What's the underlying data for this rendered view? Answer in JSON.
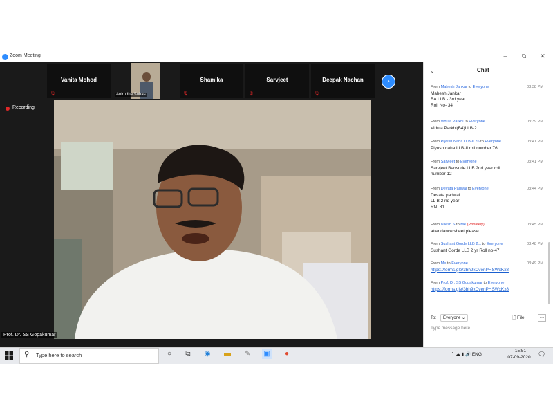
{
  "window": {
    "title": "Zoom Meeting",
    "minimize": "–",
    "restore": "⧉",
    "close": "✕"
  },
  "participants": {
    "names": [
      "Vanita Mohod",
      "Shamika",
      "Sarvjeet",
      "Deepak Nachan"
    ],
    "video_tile_label": "Anirudha Suhas",
    "next_arrow": "›"
  },
  "recording": {
    "label": "Recording"
  },
  "speaker": {
    "name": "Prof. Dr. SS Gopakumar"
  },
  "chat": {
    "title": "Chat",
    "collapse": "⌄",
    "messages": [
      {
        "from": "Mahesh Jankar",
        "to": "Everyone",
        "time": "03:38 PM",
        "lines": [
          "Mahesh Jankar",
          "BA LLB - 3rd year",
          "Roll No- 34"
        ]
      },
      {
        "from": "Vidula Parkhi",
        "to": "Everyone",
        "time": "03:39 PM",
        "lines": [
          "Vidula Parkhi(B4)LLB-2"
        ]
      },
      {
        "from": "Piyush Naha LLB-II  76",
        "to": "Everyone",
        "time": "03:41 PM",
        "lines": [
          "Piyush naha LLB-II roll number 76"
        ]
      },
      {
        "from": "Sarvjeet",
        "to": "Everyone",
        "time": "03:41 PM",
        "lines": [
          "Sarvjeet Bansode LLB 2nd year roll",
          "number 12"
        ]
      },
      {
        "from": "Devata Padwal",
        "to": "Everyone",
        "time": "03:44 PM",
        "lines": [
          "Devata padwal",
          "LL B 2 nd year",
          "RN. 81"
        ]
      },
      {
        "from": "Nilesh S",
        "to": "Me",
        "privately": "(Privately)",
        "time": "03:45 PM",
        "lines": [
          "attendance sheet please"
        ]
      },
      {
        "from": "Sushant Gorde LLB 2...",
        "to": "Everyone",
        "time": "03:48 PM",
        "lines": [
          "Sushant Gorde LLB 2 yr Roll no-47"
        ]
      },
      {
        "from": "Me",
        "to": "Everyone",
        "time": "03:49 PM",
        "link": "https://forms.gle/3bh9xCvenPHSWxKx8"
      },
      {
        "from": "Prof. Dr. SS Gopakumar",
        "to": "Everyone",
        "time": "",
        "link": "https://forms.gle/3bh9xCvenPHSWxKx8"
      }
    ],
    "from_word": "From",
    "to_word": "to",
    "to_label": "To:",
    "to_value": "Everyone ⌄",
    "file_label": "File",
    "more": "…",
    "input_placeholder": "Type message here..."
  },
  "taskbar": {
    "search_placeholder": "Type here to search",
    "tray_text": "ENG",
    "time": "15:51",
    "date": "07-09-2020"
  }
}
